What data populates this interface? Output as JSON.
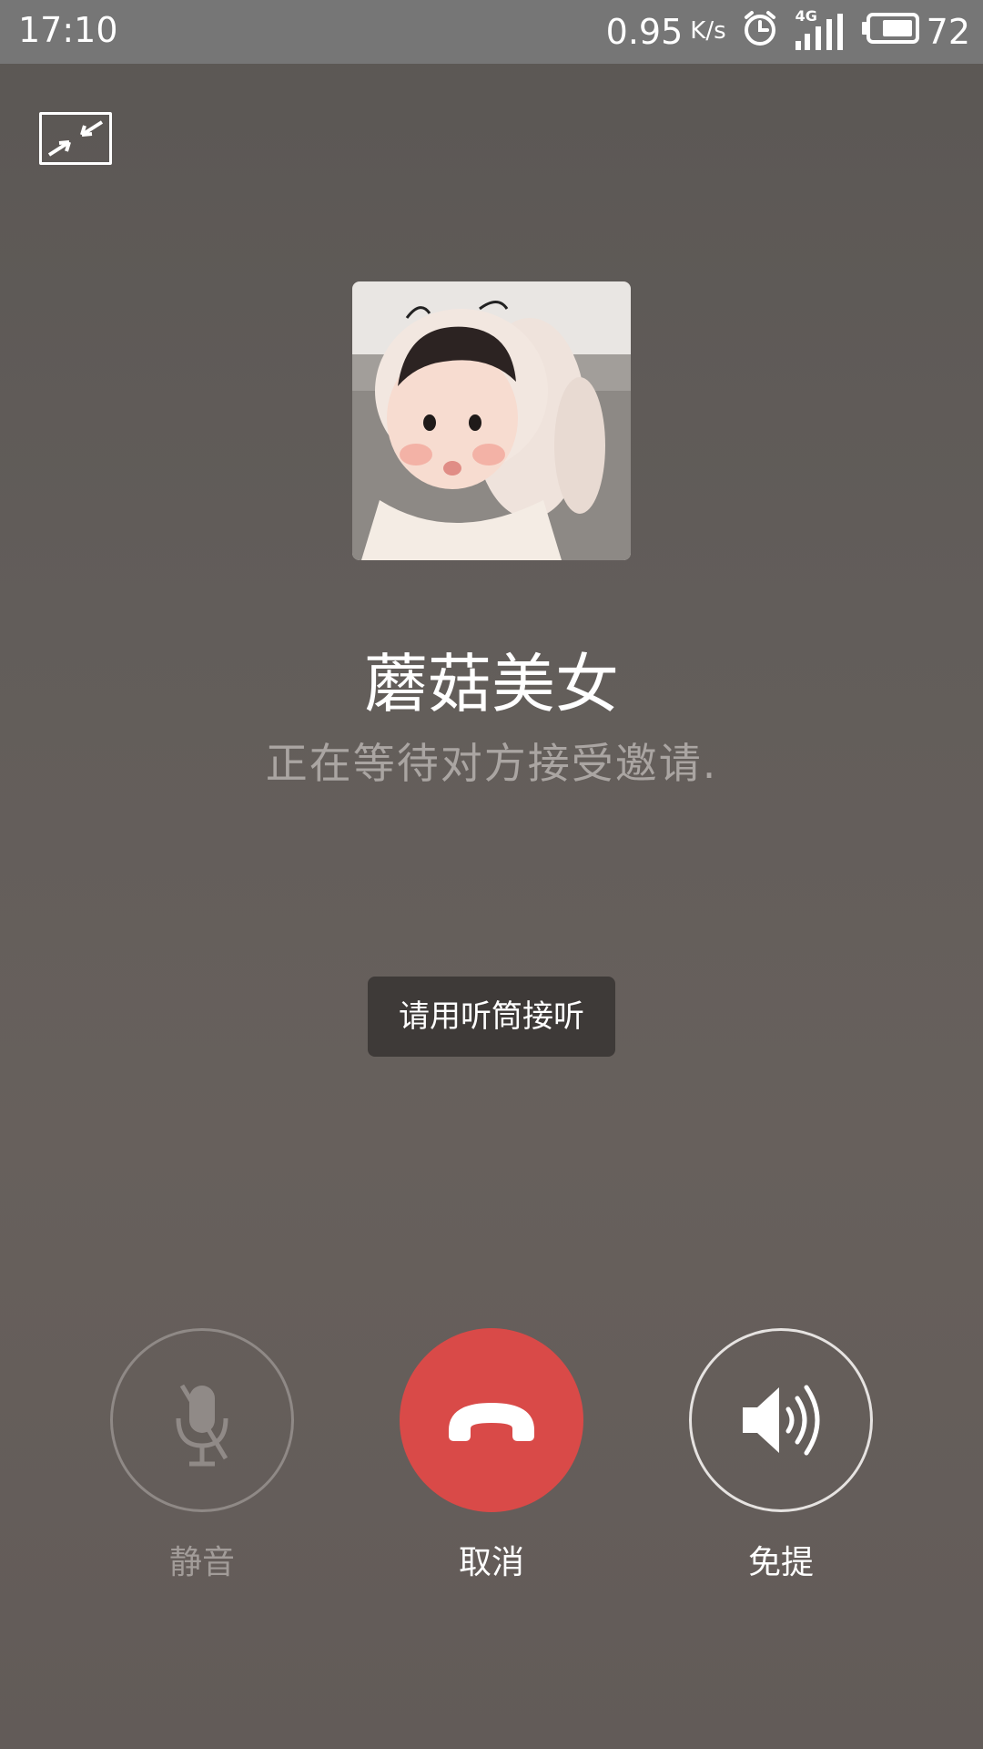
{
  "status_bar": {
    "time": "17:10",
    "net_speed": "0.95",
    "net_speed_unit": "K/s",
    "network_type": "4G",
    "battery_level": "72",
    "icons": [
      "alarm-clock-icon",
      "signal-4g-icon",
      "battery-icon"
    ]
  },
  "call": {
    "minimize_icon": "shrink-window-icon",
    "contact_name": "蘑菇美女",
    "status_text": "正在等待对方接受邀请.",
    "toast_text": "请用听筒接听"
  },
  "controls": {
    "mute": {
      "label": "静音",
      "icon": "muted-microphone-icon"
    },
    "cancel": {
      "label": "取消",
      "icon": "hang-up-phone-icon"
    },
    "speaker": {
      "label": "免提",
      "icon": "speaker-icon"
    }
  },
  "colors": {
    "cancel_button": "#d94a48",
    "status_bar": "#767676",
    "background": "#625d5a"
  }
}
